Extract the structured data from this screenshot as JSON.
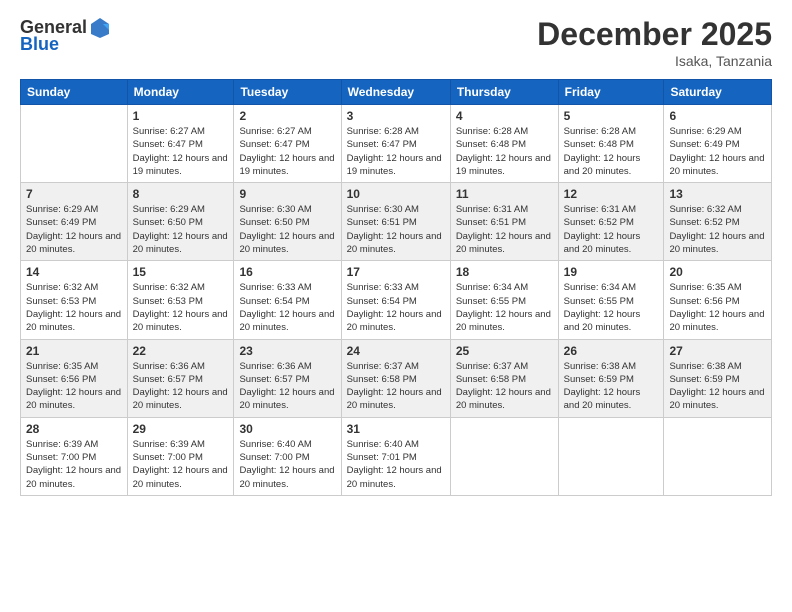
{
  "app": {
    "logo_line1": "General",
    "logo_line2": "Blue"
  },
  "header": {
    "month": "December 2025",
    "location": "Isaka, Tanzania"
  },
  "columns": [
    "Sunday",
    "Monday",
    "Tuesday",
    "Wednesday",
    "Thursday",
    "Friday",
    "Saturday"
  ],
  "weeks": [
    [
      {
        "day": "",
        "sunrise": "",
        "sunset": "",
        "daylight": ""
      },
      {
        "day": "1",
        "sunrise": "Sunrise: 6:27 AM",
        "sunset": "Sunset: 6:47 PM",
        "daylight": "Daylight: 12 hours and 19 minutes."
      },
      {
        "day": "2",
        "sunrise": "Sunrise: 6:27 AM",
        "sunset": "Sunset: 6:47 PM",
        "daylight": "Daylight: 12 hours and 19 minutes."
      },
      {
        "day": "3",
        "sunrise": "Sunrise: 6:28 AM",
        "sunset": "Sunset: 6:47 PM",
        "daylight": "Daylight: 12 hours and 19 minutes."
      },
      {
        "day": "4",
        "sunrise": "Sunrise: 6:28 AM",
        "sunset": "Sunset: 6:48 PM",
        "daylight": "Daylight: 12 hours and 19 minutes."
      },
      {
        "day": "5",
        "sunrise": "Sunrise: 6:28 AM",
        "sunset": "Sunset: 6:48 PM",
        "daylight": "Daylight: 12 hours and 20 minutes."
      },
      {
        "day": "6",
        "sunrise": "Sunrise: 6:29 AM",
        "sunset": "Sunset: 6:49 PM",
        "daylight": "Daylight: 12 hours and 20 minutes."
      }
    ],
    [
      {
        "day": "7",
        "sunrise": "Sunrise: 6:29 AM",
        "sunset": "Sunset: 6:49 PM",
        "daylight": "Daylight: 12 hours and 20 minutes."
      },
      {
        "day": "8",
        "sunrise": "Sunrise: 6:29 AM",
        "sunset": "Sunset: 6:50 PM",
        "daylight": "Daylight: 12 hours and 20 minutes."
      },
      {
        "day": "9",
        "sunrise": "Sunrise: 6:30 AM",
        "sunset": "Sunset: 6:50 PM",
        "daylight": "Daylight: 12 hours and 20 minutes."
      },
      {
        "day": "10",
        "sunrise": "Sunrise: 6:30 AM",
        "sunset": "Sunset: 6:51 PM",
        "daylight": "Daylight: 12 hours and 20 minutes."
      },
      {
        "day": "11",
        "sunrise": "Sunrise: 6:31 AM",
        "sunset": "Sunset: 6:51 PM",
        "daylight": "Daylight: 12 hours and 20 minutes."
      },
      {
        "day": "12",
        "sunrise": "Sunrise: 6:31 AM",
        "sunset": "Sunset: 6:52 PM",
        "daylight": "Daylight: 12 hours and 20 minutes."
      },
      {
        "day": "13",
        "sunrise": "Sunrise: 6:32 AM",
        "sunset": "Sunset: 6:52 PM",
        "daylight": "Daylight: 12 hours and 20 minutes."
      }
    ],
    [
      {
        "day": "14",
        "sunrise": "Sunrise: 6:32 AM",
        "sunset": "Sunset: 6:53 PM",
        "daylight": "Daylight: 12 hours and 20 minutes."
      },
      {
        "day": "15",
        "sunrise": "Sunrise: 6:32 AM",
        "sunset": "Sunset: 6:53 PM",
        "daylight": "Daylight: 12 hours and 20 minutes."
      },
      {
        "day": "16",
        "sunrise": "Sunrise: 6:33 AM",
        "sunset": "Sunset: 6:54 PM",
        "daylight": "Daylight: 12 hours and 20 minutes."
      },
      {
        "day": "17",
        "sunrise": "Sunrise: 6:33 AM",
        "sunset": "Sunset: 6:54 PM",
        "daylight": "Daylight: 12 hours and 20 minutes."
      },
      {
        "day": "18",
        "sunrise": "Sunrise: 6:34 AM",
        "sunset": "Sunset: 6:55 PM",
        "daylight": "Daylight: 12 hours and 20 minutes."
      },
      {
        "day": "19",
        "sunrise": "Sunrise: 6:34 AM",
        "sunset": "Sunset: 6:55 PM",
        "daylight": "Daylight: 12 hours and 20 minutes."
      },
      {
        "day": "20",
        "sunrise": "Sunrise: 6:35 AM",
        "sunset": "Sunset: 6:56 PM",
        "daylight": "Daylight: 12 hours and 20 minutes."
      }
    ],
    [
      {
        "day": "21",
        "sunrise": "Sunrise: 6:35 AM",
        "sunset": "Sunset: 6:56 PM",
        "daylight": "Daylight: 12 hours and 20 minutes."
      },
      {
        "day": "22",
        "sunrise": "Sunrise: 6:36 AM",
        "sunset": "Sunset: 6:57 PM",
        "daylight": "Daylight: 12 hours and 20 minutes."
      },
      {
        "day": "23",
        "sunrise": "Sunrise: 6:36 AM",
        "sunset": "Sunset: 6:57 PM",
        "daylight": "Daylight: 12 hours and 20 minutes."
      },
      {
        "day": "24",
        "sunrise": "Sunrise: 6:37 AM",
        "sunset": "Sunset: 6:58 PM",
        "daylight": "Daylight: 12 hours and 20 minutes."
      },
      {
        "day": "25",
        "sunrise": "Sunrise: 6:37 AM",
        "sunset": "Sunset: 6:58 PM",
        "daylight": "Daylight: 12 hours and 20 minutes."
      },
      {
        "day": "26",
        "sunrise": "Sunrise: 6:38 AM",
        "sunset": "Sunset: 6:59 PM",
        "daylight": "Daylight: 12 hours and 20 minutes."
      },
      {
        "day": "27",
        "sunrise": "Sunrise: 6:38 AM",
        "sunset": "Sunset: 6:59 PM",
        "daylight": "Daylight: 12 hours and 20 minutes."
      }
    ],
    [
      {
        "day": "28",
        "sunrise": "Sunrise: 6:39 AM",
        "sunset": "Sunset: 7:00 PM",
        "daylight": "Daylight: 12 hours and 20 minutes."
      },
      {
        "day": "29",
        "sunrise": "Sunrise: 6:39 AM",
        "sunset": "Sunset: 7:00 PM",
        "daylight": "Daylight: 12 hours and 20 minutes."
      },
      {
        "day": "30",
        "sunrise": "Sunrise: 6:40 AM",
        "sunset": "Sunset: 7:00 PM",
        "daylight": "Daylight: 12 hours and 20 minutes."
      },
      {
        "day": "31",
        "sunrise": "Sunrise: 6:40 AM",
        "sunset": "Sunset: 7:01 PM",
        "daylight": "Daylight: 12 hours and 20 minutes."
      },
      {
        "day": "",
        "sunrise": "",
        "sunset": "",
        "daylight": ""
      },
      {
        "day": "",
        "sunrise": "",
        "sunset": "",
        "daylight": ""
      },
      {
        "day": "",
        "sunrise": "",
        "sunset": "",
        "daylight": ""
      }
    ]
  ]
}
